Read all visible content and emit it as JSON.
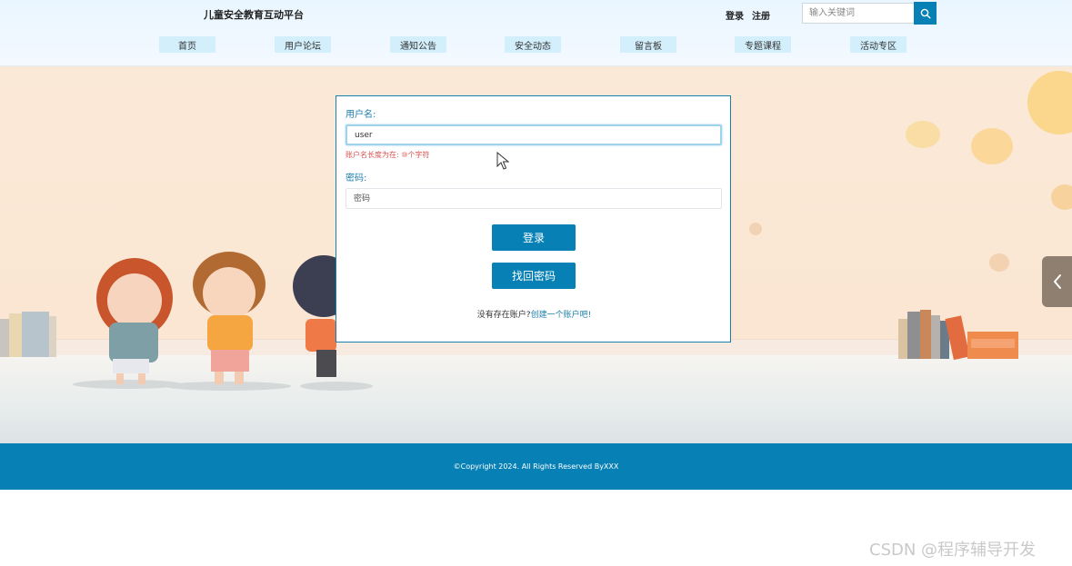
{
  "header": {
    "site_title": "儿童安全教育互动平台",
    "login_label": "登录",
    "register_label": "注册",
    "search_placeholder": "输入关键词"
  },
  "nav": {
    "items": [
      {
        "label": "首页"
      },
      {
        "label": "用户论坛"
      },
      {
        "label": "通知公告"
      },
      {
        "label": "安全动态"
      },
      {
        "label": "留言板"
      },
      {
        "label": "专题课程"
      },
      {
        "label": "活动专区"
      }
    ]
  },
  "login_form": {
    "username_label": "用户名:",
    "username_value": "user",
    "username_error": "账户名长度为在: ⑩个字符",
    "password_label": "密码:",
    "password_placeholder": "密码",
    "login_button": "登录",
    "forgot_button": "找回密码",
    "no_account_text": "没有存在账户?",
    "create_account_link": "创建一个账户吧!"
  },
  "footer": {
    "copyright": "©Copyright 2024. All Rights Reserved ByXXX"
  },
  "watermark": "CSDN @程序辅导开发",
  "icons": {
    "search": "search-icon",
    "side_arrow": "chevron-left-icon",
    "cursor": "mouse-cursor-icon"
  },
  "colors": {
    "primary": "#0780b5",
    "nav_bg": "#d2effb",
    "error": "#d9534f",
    "side_arrow_bg": "#8f7f70"
  }
}
